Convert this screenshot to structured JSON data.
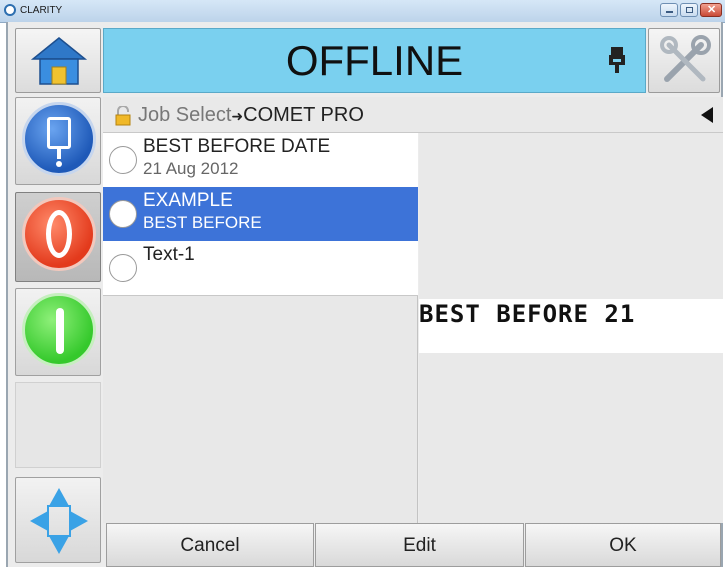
{
  "window": {
    "title": "CLARITY"
  },
  "status": {
    "text": "OFFLINE"
  },
  "breadcrumb": {
    "base": "Job Select",
    "arrow": "➜",
    "current": "COMET PRO"
  },
  "jobs": [
    {
      "line1": "BEST BEFORE DATE",
      "line2": "21 Aug 2012",
      "selected": false
    },
    {
      "line1": "EXAMPLE",
      "line2": "BEST BEFORE",
      "selected": true
    },
    {
      "line1": "Text-1",
      "line2": "",
      "selected": false
    }
  ],
  "preview": {
    "text": "BEST BEFORE 21"
  },
  "buttons": {
    "cancel": "Cancel",
    "edit": "Edit",
    "ok": "OK"
  },
  "colors": {
    "status_bg": "#7ad0ef",
    "selected_bg": "#3d73d8",
    "stop_red": "#e33a1c",
    "start_green": "#35c92c",
    "nozzle_blue": "#1e59b8"
  },
  "icons": {
    "home": "home-icon",
    "tools": "tools-icon",
    "ink": "ink-level-icon",
    "lock": "padlock-icon",
    "back": "back-triangle-icon",
    "nozzle": "nozzle-icon",
    "stop": "stop-icon",
    "start": "start-icon",
    "nav": "navigation-arrows-icon"
  }
}
